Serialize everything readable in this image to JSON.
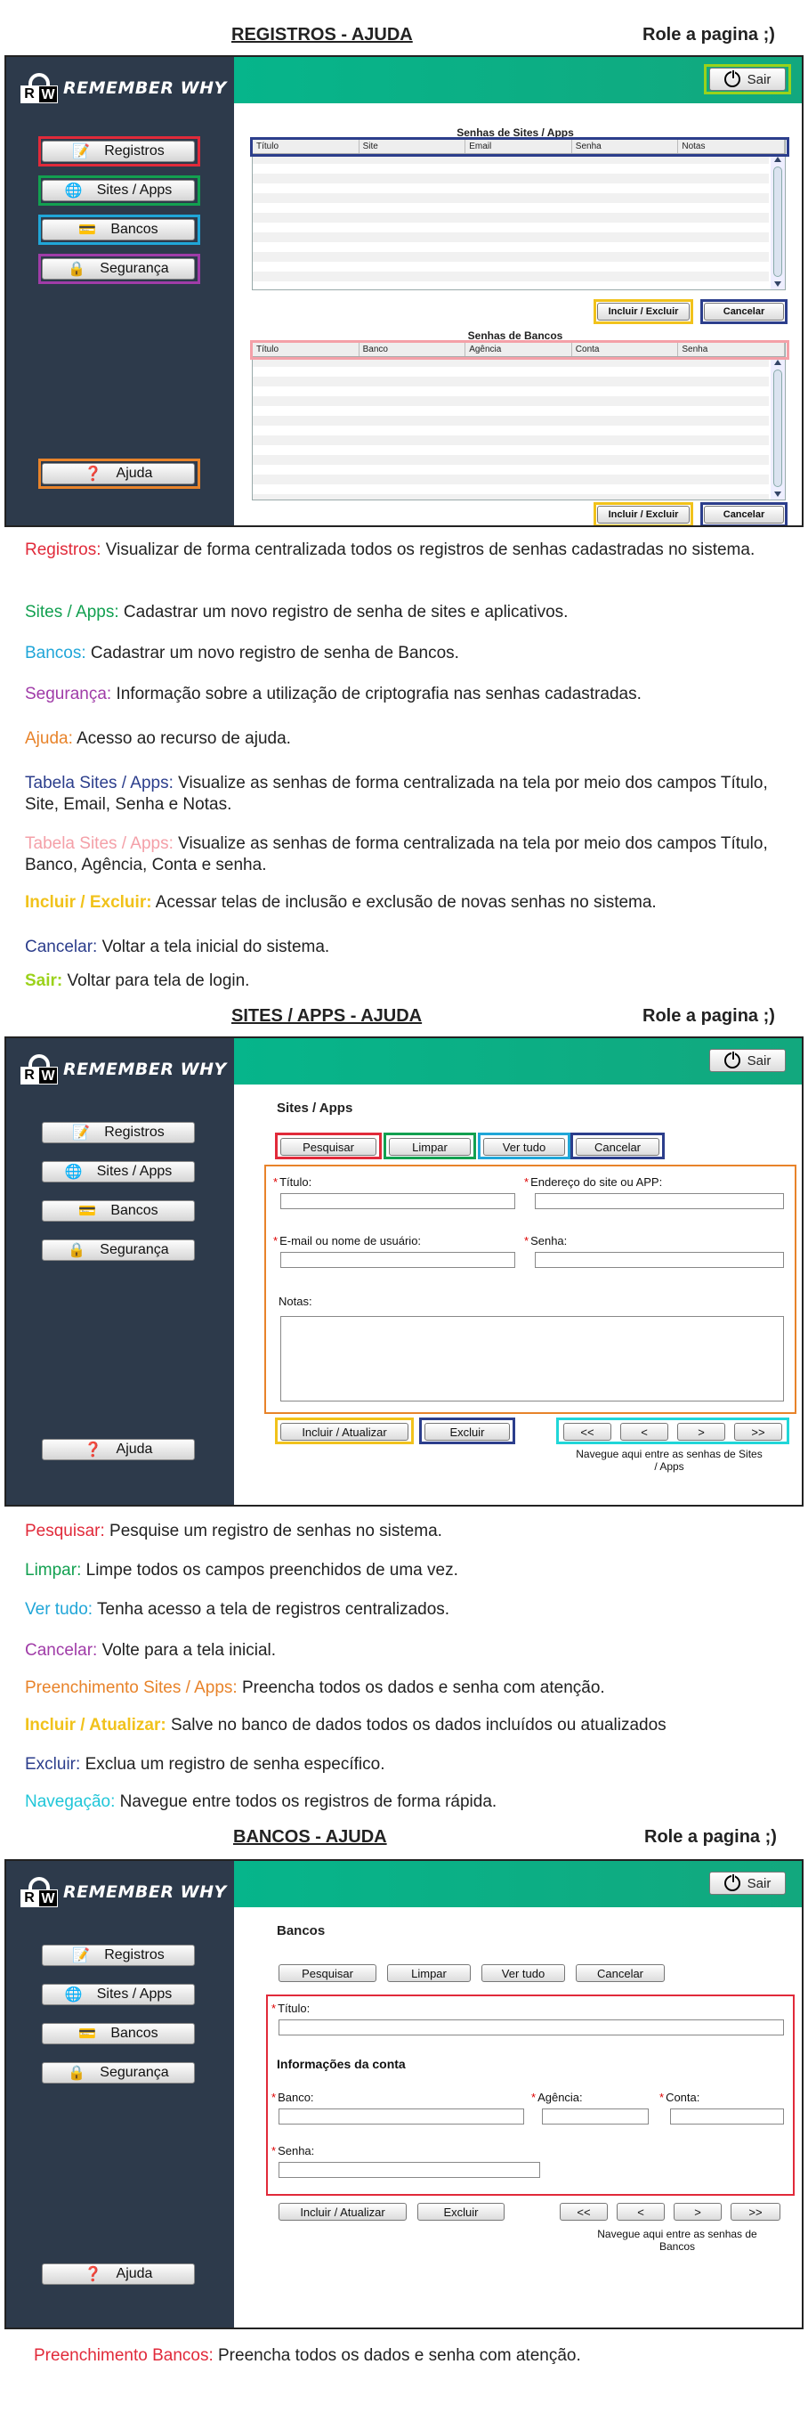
{
  "brand": {
    "logo_r": "R",
    "logo_w": "W",
    "name": "REMEMBER WHY"
  },
  "role_text": "Role a pagina ;)",
  "colors": {
    "red": "#e12a3a",
    "green": "#12a050",
    "cyan": "#20a6d8",
    "purple": "#a03ca8",
    "orange": "#e8832a",
    "navy": "#2c3e8c",
    "pink": "#f4a0a8",
    "yellow": "#f1c21b",
    "lime": "#9bd21b",
    "sidebar": "#2d3a4b",
    "topbar": "#06b58b"
  },
  "common": {
    "nav_registros": "Registros",
    "nav_sites": "Sites / Apps",
    "nav_bancos": "Bancos",
    "nav_seguranca": "Segurança",
    "nav_ajuda": "Ajuda",
    "sair": "Sair"
  },
  "sec1": {
    "title": "REGISTROS - AJUDA",
    "table1": {
      "title": "Senhas de Sites / Apps",
      "columns": [
        "Título",
        "Site",
        "Email",
        "Senha",
        "Notas"
      ]
    },
    "table2": {
      "title": "Senhas de Bancos",
      "columns": [
        "Título",
        "Banco",
        "Agência",
        "Conta",
        "Senha"
      ]
    },
    "btn_incluir": "Incluir / Excluir",
    "btn_cancelar": "Cancelar",
    "descs": [
      {
        "key": "Registros:",
        "text": " Visualizar de forma centralizada todos os registros de senhas cadastradas no sistema.",
        "color": "red"
      },
      {
        "key": "Sites / Apps:",
        "text": " Cadastrar um novo registro de senha de sites e aplicativos.",
        "color": "green"
      },
      {
        "key": "Bancos:",
        "text": " Cadastrar um novo registro de senha de Bancos.",
        "color": "cyan"
      },
      {
        "key": "Segurança:",
        "text": " Informação sobre a utilização de criptografia nas senhas cadastradas.",
        "color": "purple"
      },
      {
        "key": "Ajuda:",
        "text": " Acesso ao recurso de ajuda.",
        "color": "orange"
      },
      {
        "key": "Tabela Sites / Apps:",
        "text": "  Visualize as senhas de forma centralizada na tela por meio dos campos Título, Site, Email, Senha e Notas.",
        "color": "navy"
      },
      {
        "key": "Tabela Sites / Apps:",
        "text": " Visualize as senhas de forma centralizada na tela por meio dos campos Título, Banco, Agência, Conta e senha.",
        "color": "pink"
      },
      {
        "key": "Incluir / Excluir:",
        "text": " Acessar telas de inclusão e exclusão de novas senhas no sistema.",
        "color": "yellow"
      },
      {
        "key": "Cancelar:",
        "text": " Voltar a tela inicial do sistema.",
        "color": "navy"
      },
      {
        "key": "Sair:",
        "text": " Voltar para tela de login.",
        "color": "lime"
      }
    ]
  },
  "sec2": {
    "title": "SITES / APPS - AJUDA",
    "form_title": "Sites / Apps",
    "btn_pesquisar": "Pesquisar",
    "btn_limpar": "Limpar",
    "btn_vertudo": "Ver tudo",
    "btn_cancelar": "Cancelar",
    "lbl_titulo": "Título:",
    "lbl_endereco": "Endereço do site ou APP:",
    "lbl_email": "E-mail ou nome de usuário:",
    "lbl_senha": "Senha:",
    "lbl_notas": "Notas:",
    "btn_incluir": "Incluir / Atualizar",
    "btn_excluir": "Excluir",
    "pager": [
      "<<",
      "<",
      ">",
      ">>"
    ],
    "hint": "Navegue aqui entre as senhas de Sites / Apps",
    "descs": [
      {
        "key": "Pesquisar:",
        "text": " Pesquise um registro de senhas no sistema.",
        "color": "red"
      },
      {
        "key": "Limpar:",
        "text": " Limpe todos os campos preenchidos de uma vez.",
        "color": "green"
      },
      {
        "key": "Ver tudo:",
        "text": " Tenha acesso a tela de registros centralizados.",
        "color": "cyan"
      },
      {
        "key": "Cancelar:",
        "text": " Volte para a tela inicial.",
        "color": "purple"
      },
      {
        "key": "Preenchimento Sites / Apps:",
        "text": " Preencha todos os dados e senha com atenção.",
        "color": "orange"
      },
      {
        "key": "Incluir / Atualizar:",
        "text": " Salve no banco de dados todos os dados incluídos ou atualizados",
        "color": "yellow"
      },
      {
        "key": "Excluir:",
        "text": " Exclua um registro de senha específico.",
        "color": "navy"
      },
      {
        "key": "Navegação:",
        "text": " Navegue entre todos os registros de forma rápida.",
        "color": "cyan"
      }
    ]
  },
  "sec3": {
    "title": "BANCOS - AJUDA",
    "form_title": "Bancos",
    "btn_pesquisar": "Pesquisar",
    "btn_limpar": "Limpar",
    "btn_vertudo": "Ver tudo",
    "btn_cancelar": "Cancelar",
    "lbl_titulo": "Título:",
    "info_title": "Informações da conta",
    "lbl_banco": "Banco:",
    "lbl_agencia": "Agência:",
    "lbl_conta": "Conta:",
    "lbl_senha": "Senha:",
    "btn_incluir": "Incluir / Atualizar",
    "btn_excluir": "Excluir",
    "pager": [
      "<<",
      "<",
      ">",
      ">>"
    ],
    "hint": "Navegue aqui entre as senhas de Bancos",
    "descs": [
      {
        "key": "Preenchimento Bancos:",
        "text": " Preencha todos os dados e senha com atenção.",
        "color": "red"
      }
    ]
  }
}
